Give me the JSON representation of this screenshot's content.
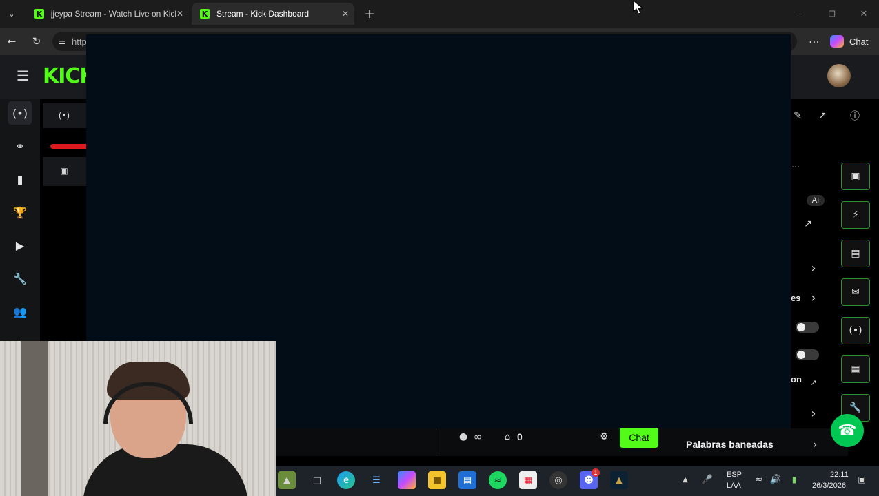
{
  "browser": {
    "tabs": [
      {
        "title": "jjeypa Stream - Watch Live on Kick",
        "active": false
      },
      {
        "title": "Stream - Kick Dashboard",
        "active": true
      }
    ],
    "address_prefix": "http",
    "copilot_label": "Chat"
  },
  "kick": {
    "logo_text": "KICK",
    "nav_icons": [
      "stream-icon",
      "link-icon",
      "analytics-icon",
      "trophy-icon",
      "video-icon",
      "wrench-icon",
      "community-icon"
    ],
    "chat_footer": {
      "kicks_value": "0",
      "chat_button": "Chat"
    },
    "banned_words_label": "Palabras baneadas",
    "partial_labels": {
      "label_ai": "AI",
      "label_es": "es",
      "label_on": "on"
    }
  },
  "taskbar": {
    "lang_top": "ESP",
    "lang_bottom": "LAA",
    "time": "22:11",
    "date": "26/3/2026",
    "discord_badge": "1"
  }
}
